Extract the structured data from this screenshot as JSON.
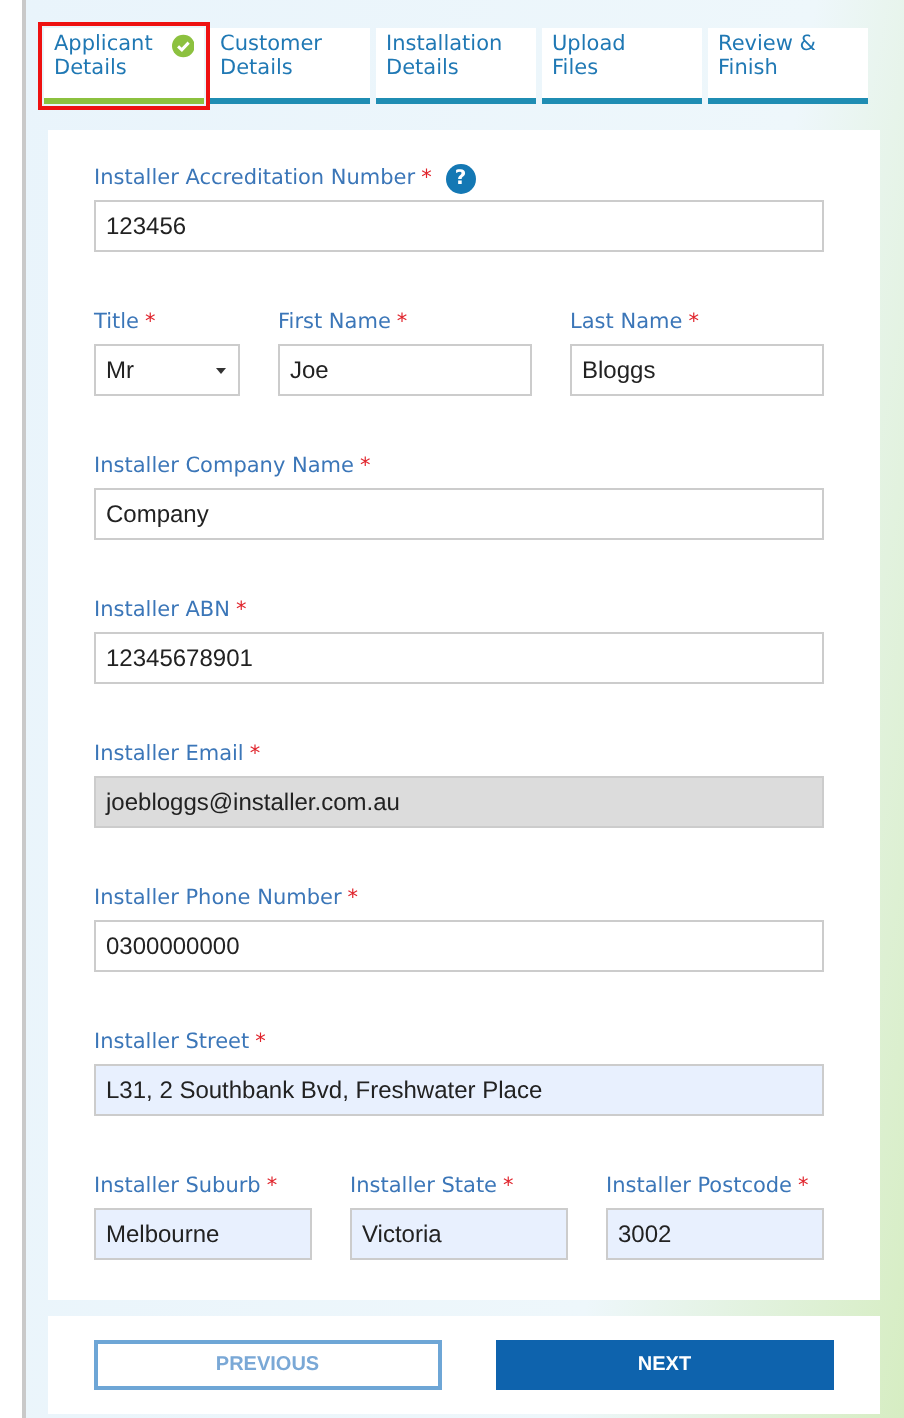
{
  "tabs": [
    {
      "label": "Applicant Details",
      "selected": true,
      "completed": true,
      "highlighted": true
    },
    {
      "label": "Customer Details",
      "selected": false,
      "completed": false,
      "highlighted": false
    },
    {
      "label": "Installation Details",
      "selected": false,
      "completed": false,
      "highlighted": false
    },
    {
      "label": "Upload Files",
      "selected": false,
      "completed": false,
      "highlighted": false
    },
    {
      "label": "Review & Finish",
      "selected": false,
      "completed": false,
      "highlighted": false
    }
  ],
  "form": {
    "rows": [
      [
        {
          "label": "Installer Accreditation Number",
          "required_mark": "*",
          "help": "?",
          "kind": "text",
          "value": "123456",
          "disabled": false,
          "autofilled": false
        }
      ],
      [
        {
          "label": "Title",
          "required_mark": "*",
          "kind": "select",
          "value": "Mr"
        },
        {
          "label": "First Name",
          "required_mark": "*",
          "kind": "text",
          "value": "Joe",
          "disabled": false,
          "autofilled": false
        },
        {
          "label": "Last Name",
          "required_mark": "*",
          "kind": "text",
          "value": "Bloggs",
          "disabled": false,
          "autofilled": false
        }
      ],
      [
        {
          "label": "Installer Company Name",
          "required_mark": "*",
          "kind": "text",
          "value": "Company",
          "disabled": false,
          "autofilled": false
        }
      ],
      [
        {
          "label": "Installer ABN",
          "required_mark": "*",
          "kind": "text",
          "value": "12345678901",
          "disabled": false,
          "autofilled": false
        }
      ],
      [
        {
          "label": "Installer Email",
          "required_mark": "*",
          "kind": "text",
          "value": "joebloggs@installer.com.au",
          "disabled": true,
          "autofilled": false
        }
      ],
      [
        {
          "label": "Installer Phone Number",
          "required_mark": "*",
          "kind": "text",
          "value": "0300000000",
          "disabled": false,
          "autofilled": false
        }
      ],
      [
        {
          "label": "Installer Street",
          "required_mark": "*",
          "kind": "text",
          "value": "L31, 2 Southbank Bvd, Freshwater Place",
          "disabled": false,
          "autofilled": true
        }
      ],
      [
        {
          "label": "Installer Suburb",
          "required_mark": "*",
          "kind": "text",
          "value": "Melbourne",
          "disabled": false,
          "autofilled": true
        },
        {
          "label": "Installer State",
          "required_mark": "*",
          "kind": "text",
          "value": "Victoria",
          "disabled": false,
          "autofilled": true
        },
        {
          "label": "Installer Postcode",
          "required_mark": "*",
          "kind": "text",
          "value": "3002",
          "disabled": false,
          "autofilled": true
        }
      ]
    ]
  },
  "buttons": [
    {
      "label": "PREVIOUS",
      "kind": "secondary"
    },
    {
      "label": "NEXT",
      "kind": "primary"
    }
  ]
}
